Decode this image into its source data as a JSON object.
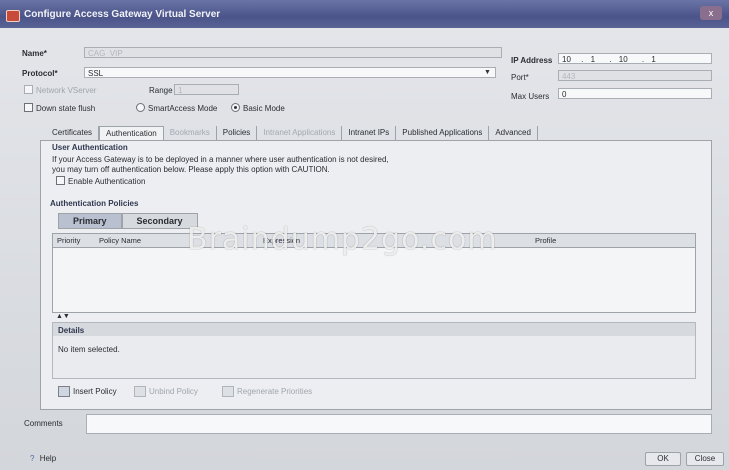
{
  "window": {
    "title": "Configure Access Gateway Virtual Server",
    "close_label": "x"
  },
  "general": {
    "name_label": "Name*",
    "name_value": "CAG_VIP",
    "ip_label": "IP Address",
    "ip_octets": [
      "10",
      "1",
      "10",
      "1"
    ],
    "protocol_label": "Protocol*",
    "protocol_value": "SSL",
    "port_label": "Port*",
    "port_value": "443",
    "network_vserver_label": "Network VServer",
    "range_label": "Range",
    "range_value": "1",
    "max_users_label": "Max Users",
    "max_users_value": "0",
    "down_state_flush_label": "Down state flush",
    "smartaccess_label": "SmartAccess Mode",
    "basic_mode_label": "Basic Mode"
  },
  "tabs": [
    {
      "label": "Certificates",
      "state": "normal"
    },
    {
      "label": "Authentication",
      "state": "active"
    },
    {
      "label": "Bookmarks",
      "state": "disabled"
    },
    {
      "label": "Policies",
      "state": "normal"
    },
    {
      "label": "Intranet Applications",
      "state": "disabled"
    },
    {
      "label": "Intranet IPs",
      "state": "normal"
    },
    {
      "label": "Published Applications",
      "state": "normal"
    },
    {
      "label": "Advanced",
      "state": "normal"
    }
  ],
  "user_auth": {
    "title": "User Authentication",
    "line1": "If your Access Gateway is to be deployed in a manner where user authentication is not desired,",
    "line2": "you may turn off authentication below. Please apply this option with CAUTION.",
    "enable_label": "Enable Authentication"
  },
  "auth_policies": {
    "title": "Authentication Policies",
    "subtabs": [
      "Primary",
      "Secondary"
    ],
    "columns": [
      "Priority",
      "Policy Name",
      "Expression",
      "Profile"
    ]
  },
  "details": {
    "title": "Details",
    "empty_text": "No item selected."
  },
  "toolbar": {
    "insert_policy": "Insert Policy",
    "unbind_policy": "Unbind Policy",
    "regenerate": "Regenerate Priorities"
  },
  "comments_label": "Comments",
  "footer": {
    "help": "Help",
    "ok": "OK",
    "close": "Close"
  },
  "watermark": "Braindump2go.com"
}
